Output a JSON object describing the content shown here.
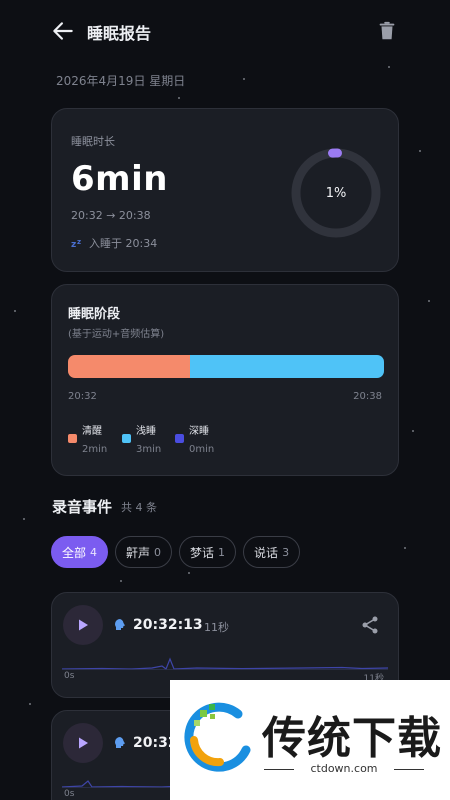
{
  "header": {
    "title": "睡眠报告",
    "back_icon": "arrow-left-icon",
    "delete_icon": "trash-icon"
  },
  "date": "2026年4月19日 星期日",
  "duration_card": {
    "label": "睡眠时长",
    "value": "6min",
    "time_range": "20:32 → 20:38",
    "asleep_text": "入睡于 20:34",
    "ring_percent": 1,
    "ring_label": "1%",
    "ring_color": "#9b7bf2"
  },
  "stages_card": {
    "title": "睡眠阶段",
    "subtitle": "(基于运动+音频估算)",
    "start": "20:32",
    "end": "20:38",
    "segments": [
      {
        "name": "清醒",
        "fraction": 0.385,
        "color": "#f58a6b"
      },
      {
        "name": "浅睡",
        "fraction": 0.615,
        "color": "#4fc3f7"
      }
    ],
    "legend": [
      {
        "name": "清醒",
        "value": "2min",
        "color": "#f58a6b"
      },
      {
        "name": "浅睡",
        "value": "3min",
        "color": "#4fc3f7"
      },
      {
        "name": "深睡",
        "value": "0min",
        "color": "#4a4de0"
      }
    ]
  },
  "events": {
    "title": "录音事件",
    "count_text": "共 4 条",
    "filters": [
      {
        "label": "全部",
        "count": "4",
        "active": true
      },
      {
        "label": "鼾声",
        "count": "0",
        "active": false
      },
      {
        "label": "梦话",
        "count": "1",
        "active": false
      },
      {
        "label": "说话",
        "count": "3",
        "active": false
      }
    ],
    "recordings": [
      {
        "time": "20:32:13",
        "duration": "11秒",
        "start_label": "0s",
        "end_label": "11秒"
      },
      {
        "time": "20:32:",
        "duration": "",
        "start_label": "0s",
        "end_label": ""
      }
    ]
  },
  "watermark": {
    "text": "传统下载",
    "url": "ctdown.com"
  }
}
